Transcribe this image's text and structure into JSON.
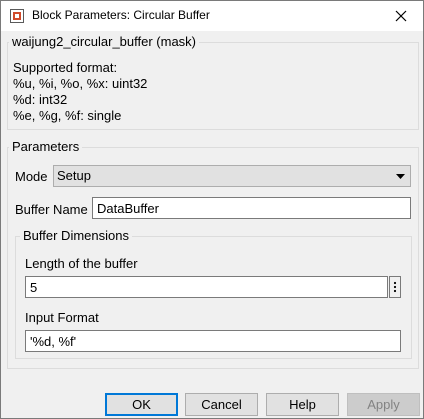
{
  "window": {
    "title": "Block Parameters: Circular Buffer"
  },
  "mask": {
    "title": "waijung2_circular_buffer (mask)",
    "description": [
      "Supported format:",
      "%u, %i, %o, %x: uint32",
      "%d: int32",
      "%e, %g, %f: single"
    ]
  },
  "parameters": {
    "group_label": "Parameters",
    "mode": {
      "label": "Mode",
      "value": "Setup"
    },
    "buffer_name": {
      "label": "Buffer Name",
      "value": "DataBuffer"
    },
    "buffer_dimensions": {
      "group_label": "Buffer Dimensions",
      "length": {
        "label": "Length of the buffer",
        "value": "5"
      },
      "input_format": {
        "label": "Input Format",
        "value": "'%d, %f'"
      }
    }
  },
  "buttons": {
    "ok": "OK",
    "cancel": "Cancel",
    "help": "Help",
    "apply": "Apply"
  },
  "icons": {
    "app": "simulink-block-icon",
    "close": "close-icon",
    "dropdown": "chevron-down-icon",
    "more": "vertical-ellipsis-icon"
  },
  "colors": {
    "default_button_border": "#0078d7",
    "dialog_bg": "#f0f0f0"
  }
}
